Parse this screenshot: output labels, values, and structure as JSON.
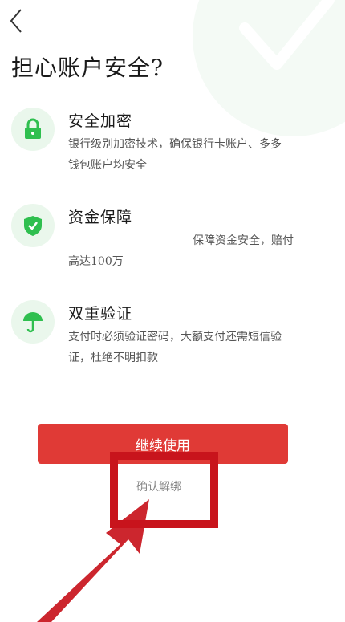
{
  "header": {
    "back_icon": "chevron-left-icon"
  },
  "page": {
    "title": "担心账户安全?"
  },
  "features": [
    {
      "icon": "lock-icon",
      "title": "安全加密",
      "desc_line1": "银行级别加密技术，确保银行卡账户、多多",
      "desc_line2": "钱包账户均安全"
    },
    {
      "icon": "shield-check-icon",
      "title": "资金保障",
      "desc_line1": "保障资金安全，赔付",
      "desc_line2": "高达100万"
    },
    {
      "icon": "umbrella-icon",
      "title": "双重验证",
      "desc_line1": "支付时必须验证密码，大额支付还需短信验",
      "desc_line2": "证，杜绝不明扣款"
    }
  ],
  "actions": {
    "continue_label": "继续使用",
    "unbind_label": "确认解绑"
  },
  "colors": {
    "accent_red": "#e03a36",
    "icon_green": "#2fbf4f",
    "icon_bg": "#eaf7ec",
    "annotation_red": "#c8141c"
  }
}
